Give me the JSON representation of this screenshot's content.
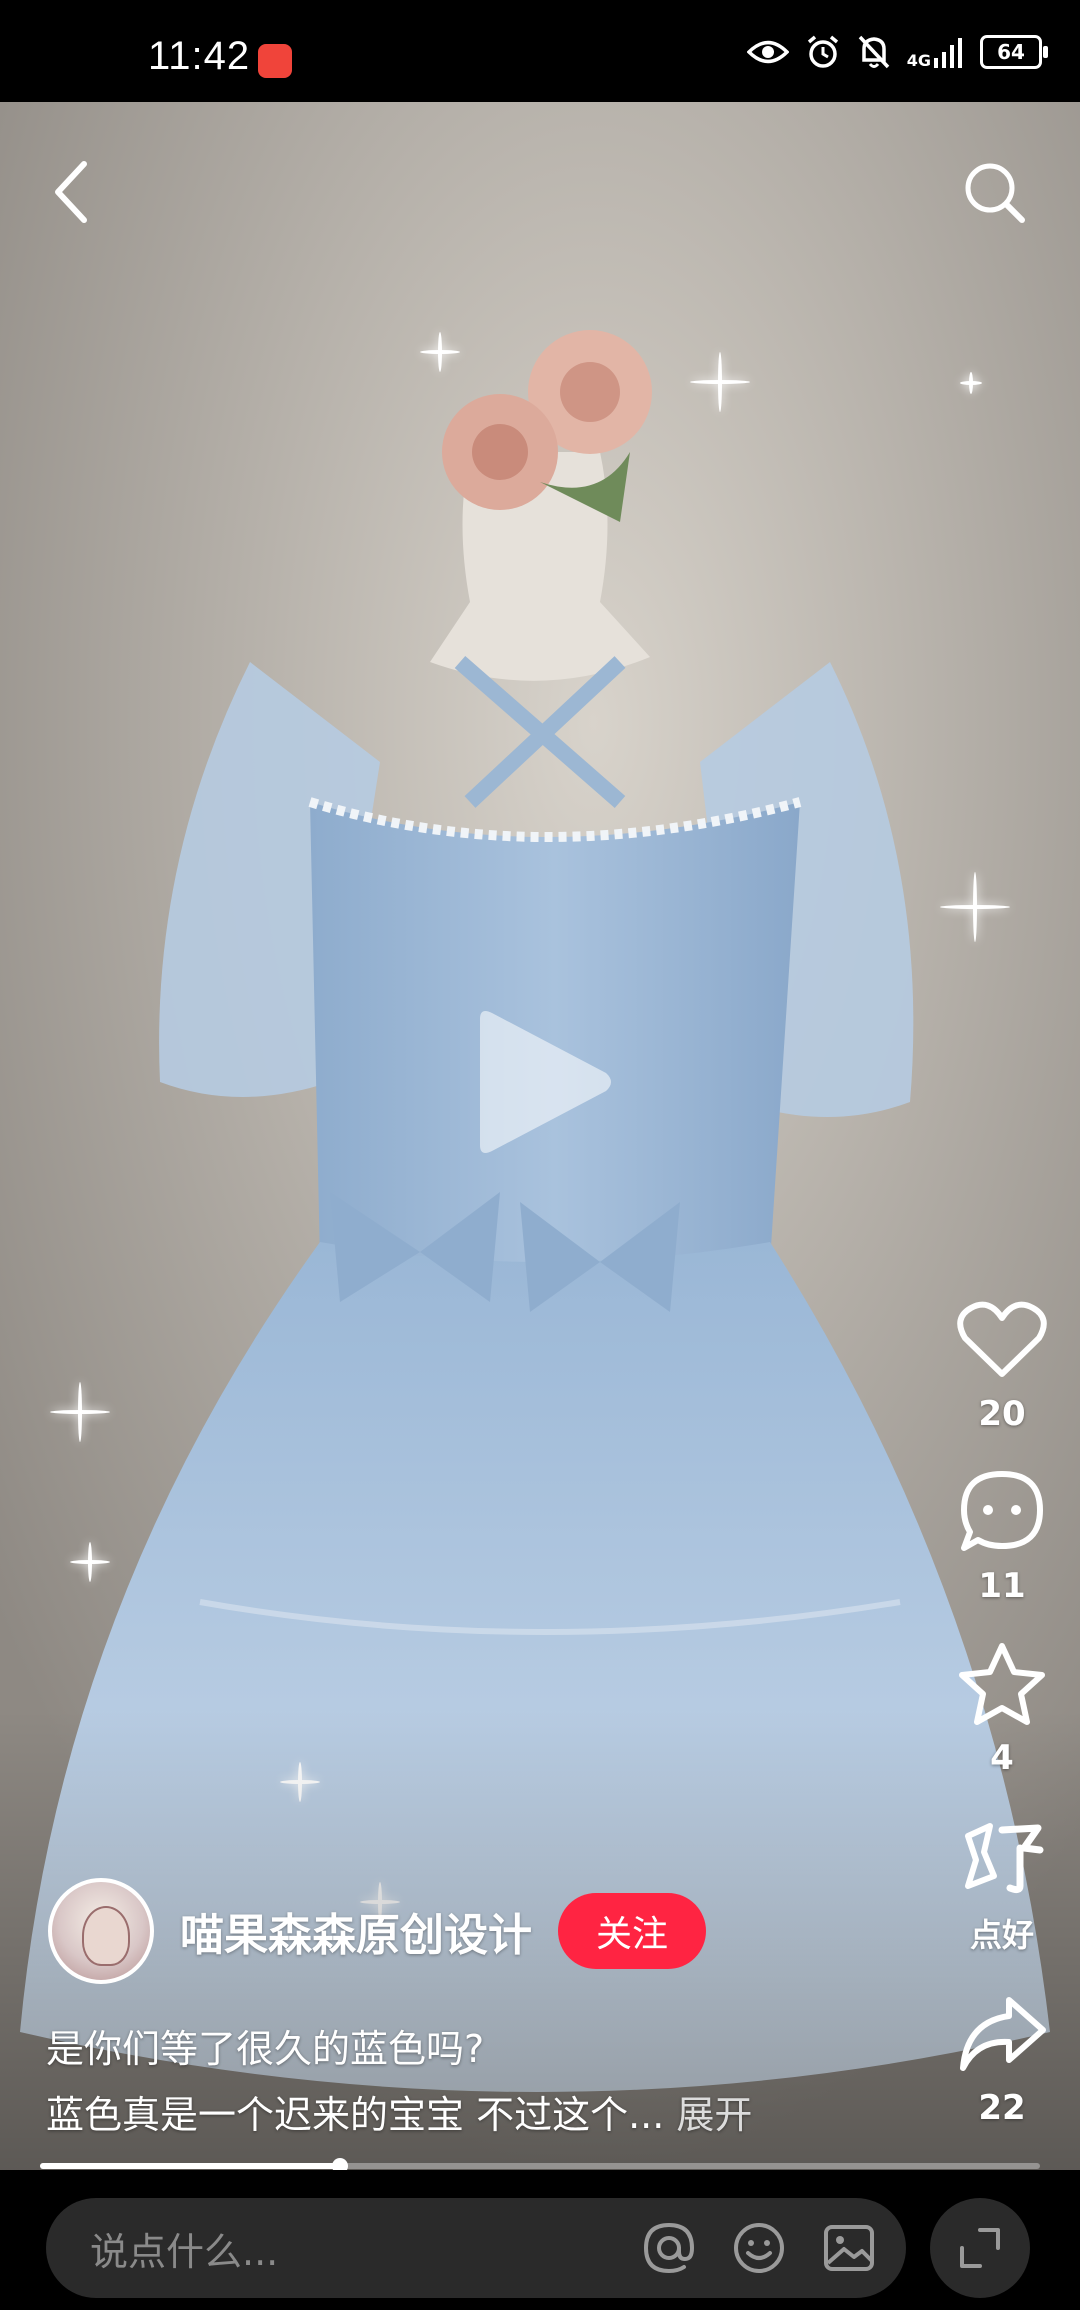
{
  "status_bar": {
    "time": "11:42",
    "network_label": "4G",
    "battery_level": "64",
    "icons": [
      "eye-icon",
      "alarm-icon",
      "bell-off-icon",
      "signal-icon",
      "battery-icon"
    ]
  },
  "header": {
    "back_icon": "chevron-left-icon",
    "search_icon": "search-icon"
  },
  "actions": {
    "like_count": "20",
    "comment_count": "11",
    "favorite_count": "4",
    "good_label": "点好",
    "share_count": "22"
  },
  "author": {
    "name": "喵果森森原创设计",
    "follow_label": "关注"
  },
  "description": {
    "line1": "是你们等了很久的蓝色吗?",
    "line2": "蓝色真是一个迟来的宝宝 不过这个...",
    "more_label": "展开"
  },
  "progress": {
    "fraction": 0.3
  },
  "comment_bar": {
    "placeholder": "说点什么...",
    "icons": [
      "at-icon",
      "emoji-icon",
      "image-icon",
      "expand-icon"
    ]
  },
  "colors": {
    "accent": "#ff2442",
    "dress": "#9fbbd8"
  }
}
